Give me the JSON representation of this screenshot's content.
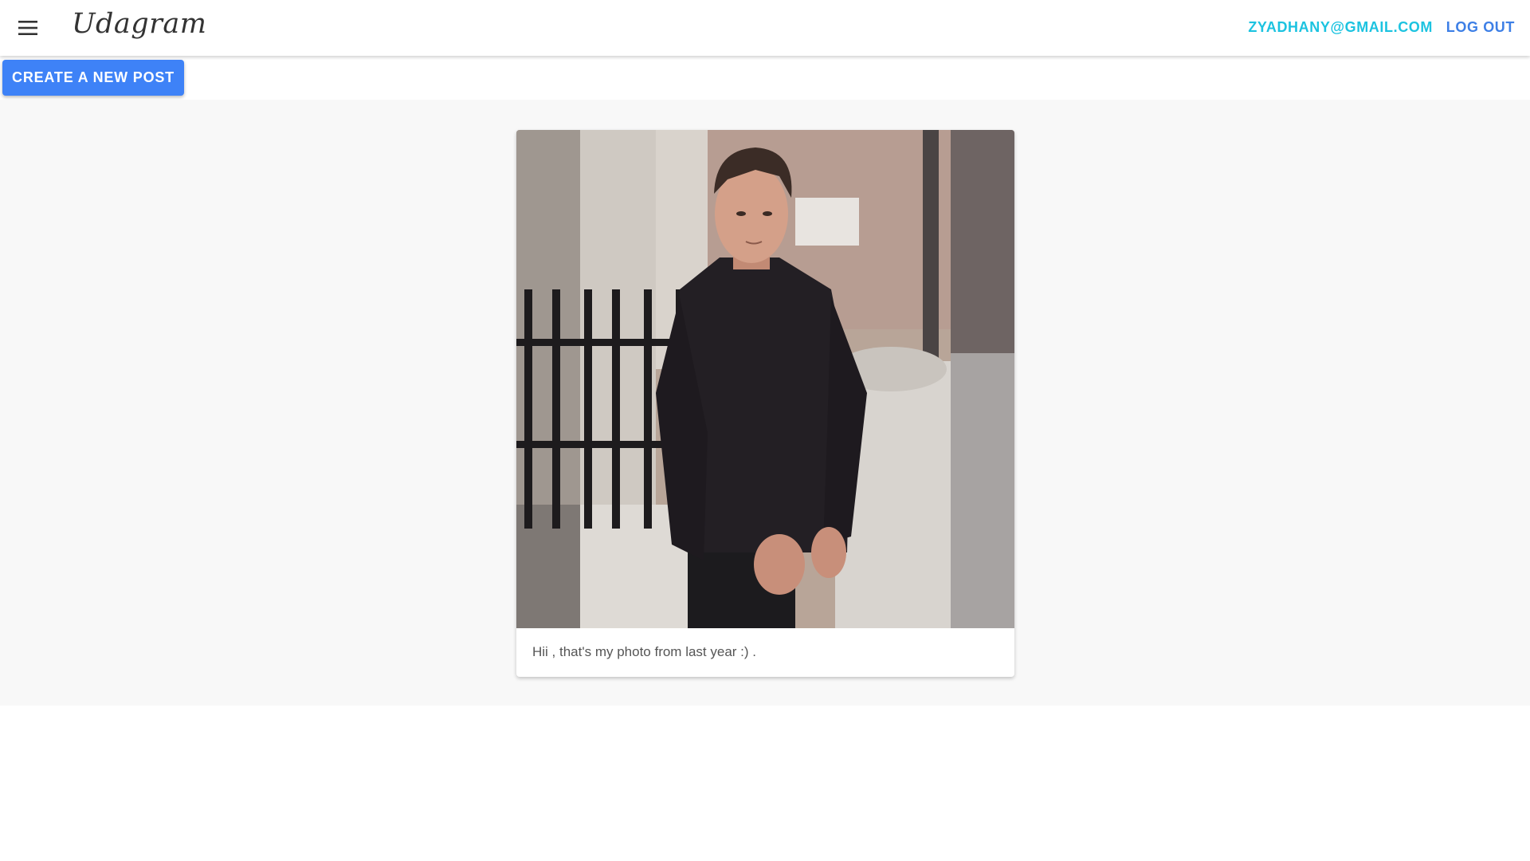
{
  "header": {
    "app_name": "Udagram",
    "menu_icon": "hamburger-menu-icon",
    "user_email": "ZYADHANY@GMAIL.COM",
    "logout_label": "LOG OUT"
  },
  "actions": {
    "create_post_label": "CREATE A NEW POST"
  },
  "feed": {
    "posts": [
      {
        "caption": "Hii , that's my photo from last year :) ."
      }
    ]
  },
  "colors": {
    "primary_button": "#3e82f7",
    "email_link": "#1cc3e0",
    "logout_link": "#3d7fe6",
    "feed_background": "#f8f8f8"
  }
}
